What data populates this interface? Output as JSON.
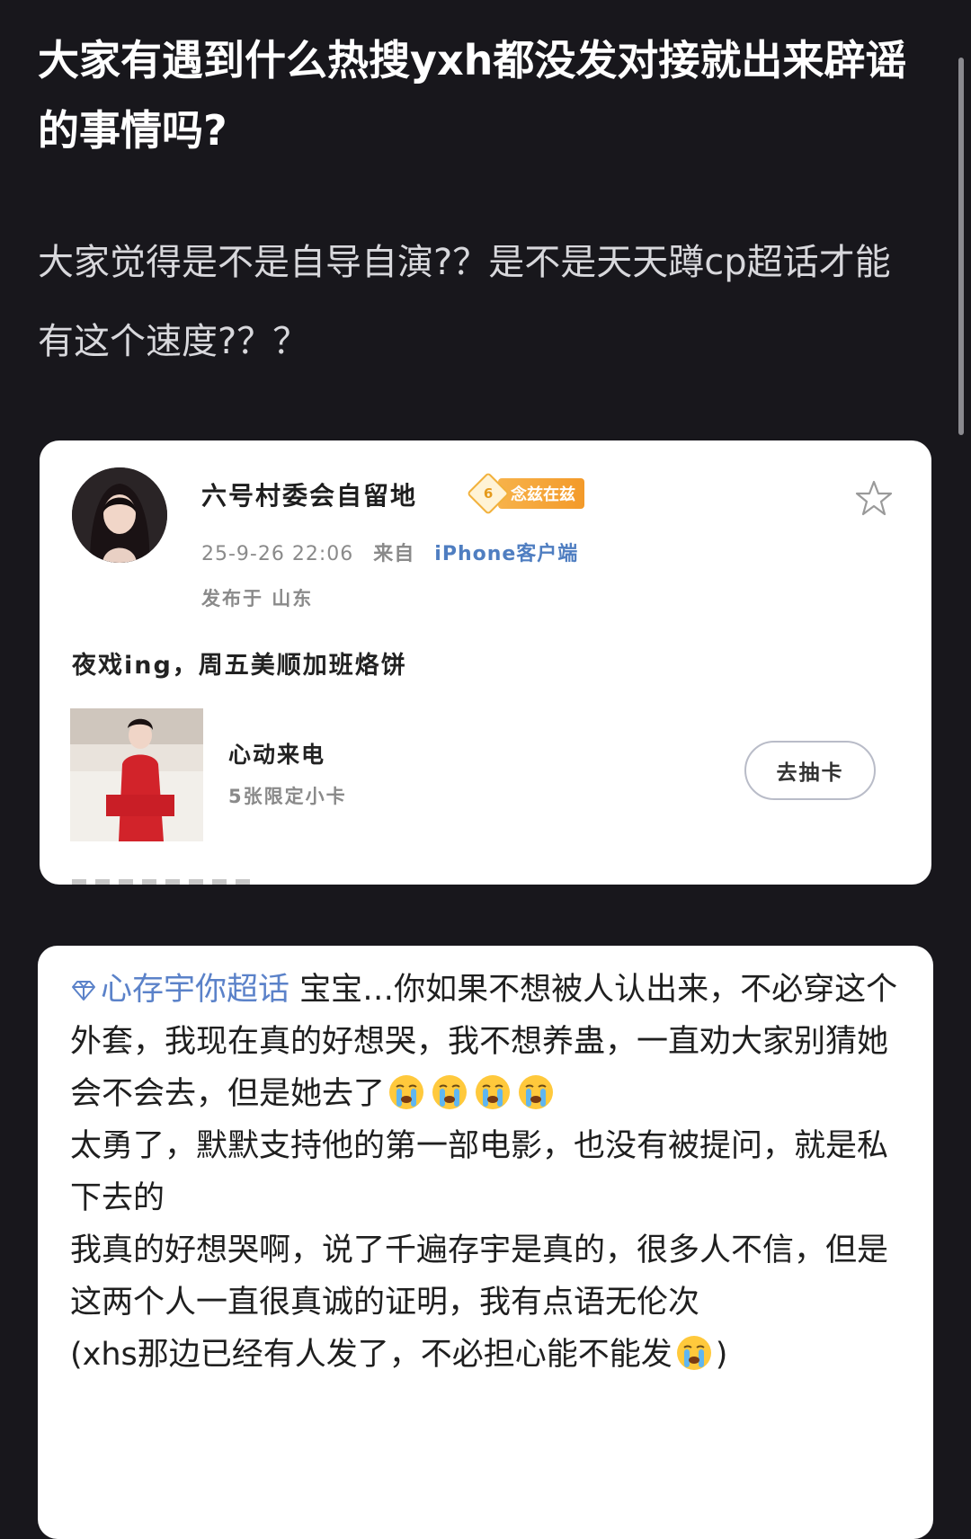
{
  "post": {
    "title": "大家有遇到什么热搜yxh都没发对接就出来辟谣的事情吗?",
    "body": "大家觉得是不是自导自演?？是不是天天蹲cp超话才能有这个速度?？？"
  },
  "weibo_card": {
    "username": "六号村委会自留地",
    "badge_level": "6",
    "badge_text": "念兹在兹",
    "timestamp": "25-9-26 22:06",
    "from_label": "来自",
    "client": "iPhone客户端",
    "location": "发布于 山东",
    "text": "夜戏ing，周五美顺加班烙饼",
    "card_title": "心动来电",
    "card_subtitle": "5张限定小卡",
    "draw_button": "去抽卡",
    "icons": {
      "star": "star-outline-icon"
    }
  },
  "chat_card": {
    "supertopic": "心存宇你超话",
    "lines": [
      " 宝宝…你如果不想被人认出来，不必穿这个外套，我现在真的好想哭，我不想养蛊，一直劝大家别猜她会不会去，但是她去了",
      "太勇了，默默支持他的第一部电影，也没有被提问，就是私下去的",
      "我真的好想哭啊，说了千遍存宇是真的，很多人不信，但是这两个人一直很真诚的证明，我有点语无伦次",
      "(xhs那边已经有人发了，不必担心能不能发"
    ],
    "line4_end": ")",
    "icons": {
      "gem": "diamond-icon",
      "emoji": "crying-face-emoji-icon"
    }
  }
}
